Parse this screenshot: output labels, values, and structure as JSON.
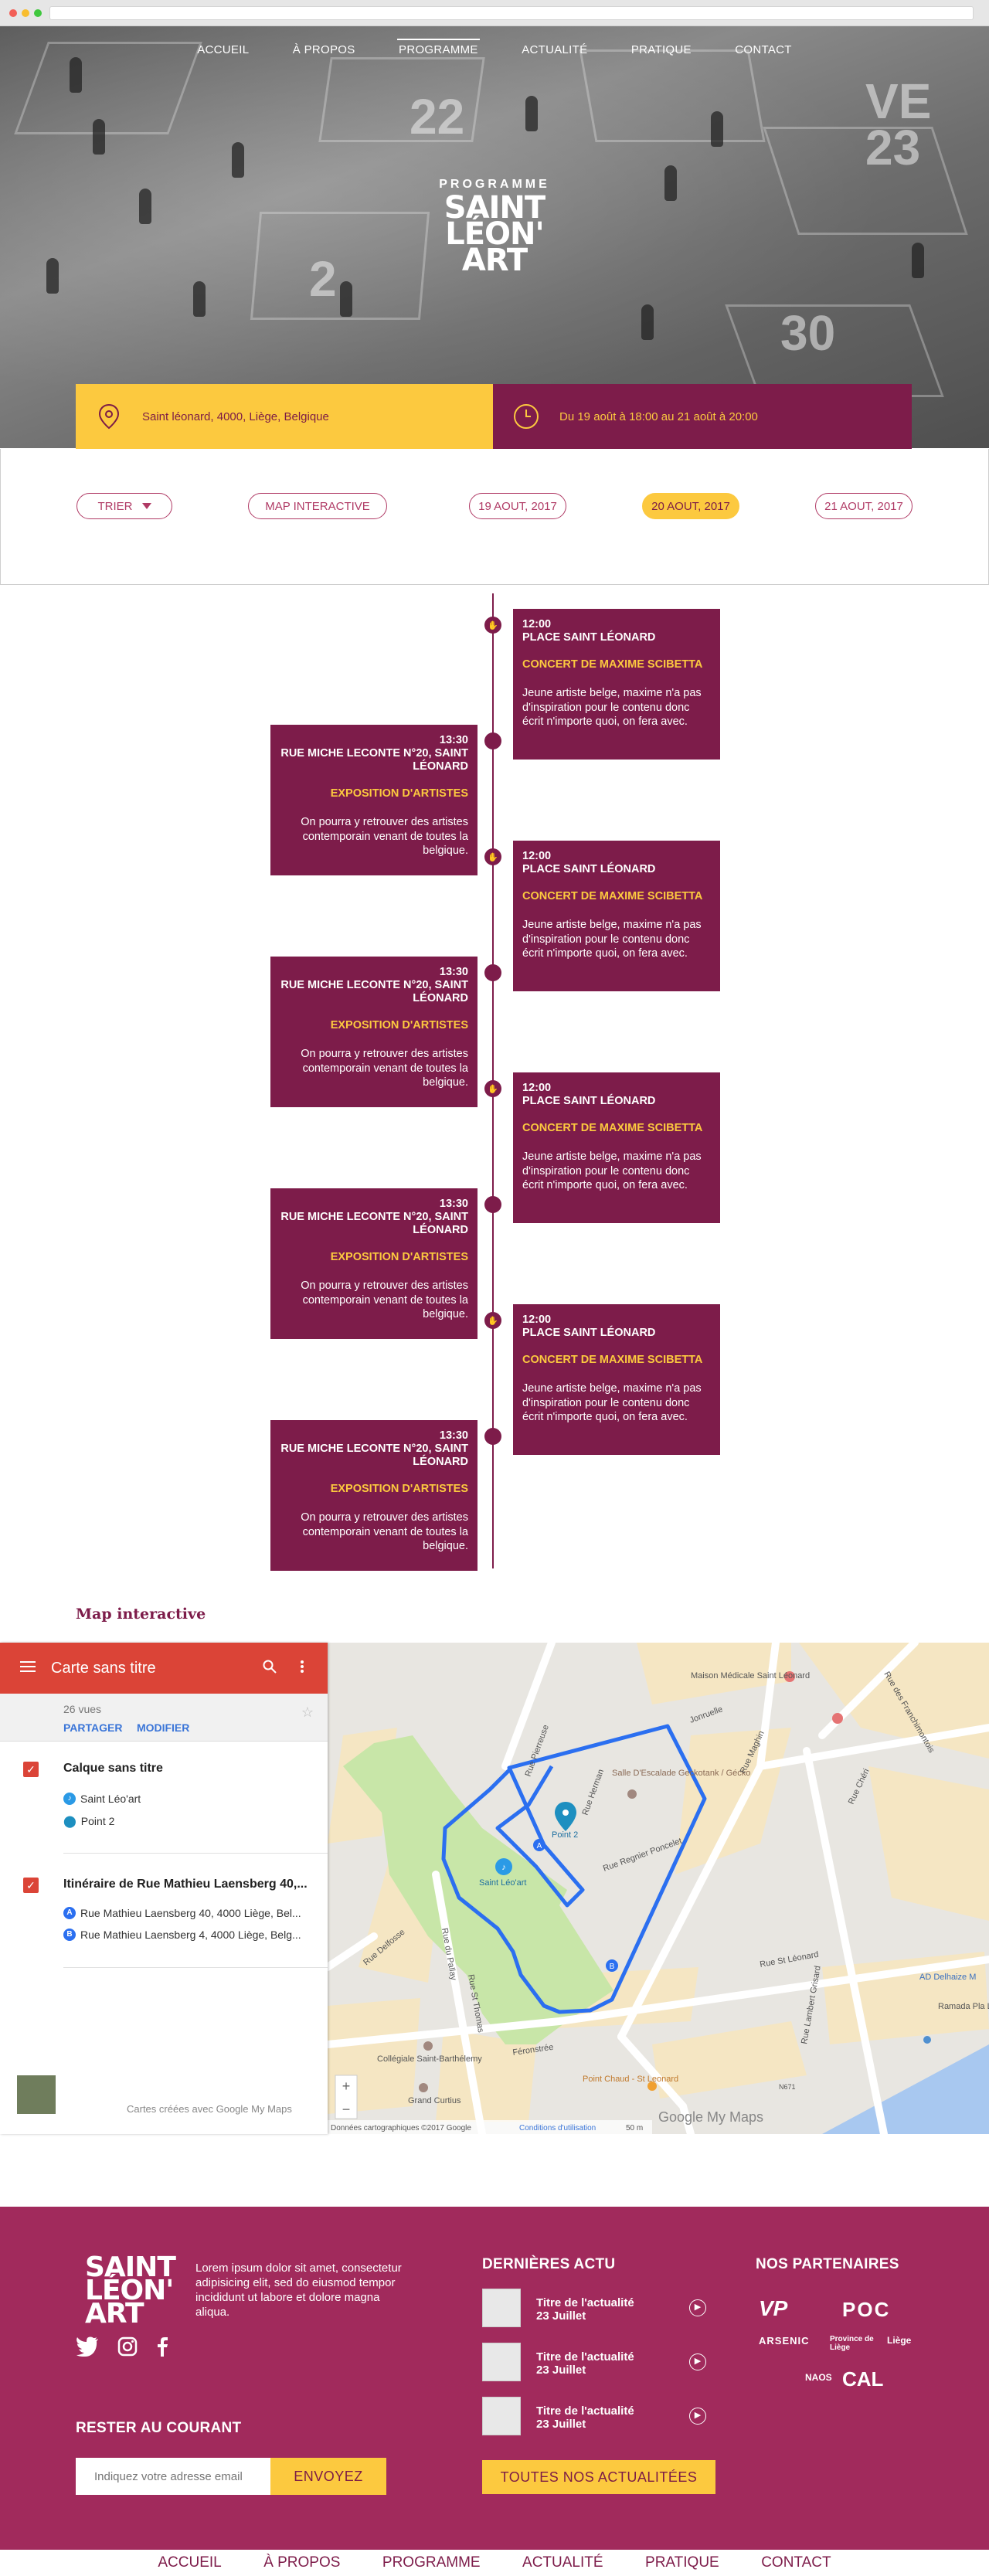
{
  "nav": {
    "items": [
      "ACCUEIL",
      "À PROPOS",
      "PROGRAMME",
      "ACTUALITÉ",
      "PRATIQUE",
      "CONTACT"
    ],
    "active": "PROGRAMME"
  },
  "hero": {
    "subtitle": "PROGRAMME",
    "logo_lines": [
      "SAINT",
      "LÉON'",
      "ART"
    ],
    "location": "Saint léonard, 4000, Liège, Belgique",
    "dates": "Du 19 août à 18:00 au 21 août à 20:00"
  },
  "filters": {
    "sort_label": "TRIER",
    "map_label": "MAP INTERACTIVE",
    "days": [
      "19 AOUT, 2017",
      "20 AOUT, 2017",
      "21 AOUT, 2017"
    ],
    "selected_day": "20 AOUT, 2017"
  },
  "timeline": {
    "events": [
      {
        "side": "right",
        "time": "12:00",
        "place": "PLACE SAINT LÉONARD",
        "title": "CONCERT DE MAXIME SCIBETTA",
        "desc": "Jeune artiste belge, maxime n'a pas d'inspiration pour le contenu donc écrit n'importe quoi, on fera avec."
      },
      {
        "side": "left",
        "time": "13:30",
        "place": "RUE MICHE LECONTE N°20, SAINT LÉONARD",
        "title": "EXPOSITION D'ARTISTES",
        "desc": "On pourra y retrouver des artistes contemporain venant de toutes la belgique."
      },
      {
        "side": "right",
        "time": "12:00",
        "place": "PLACE SAINT LÉONARD",
        "title": "CONCERT DE MAXIME SCIBETTA",
        "desc": "Jeune artiste belge, maxime n'a pas d'inspiration pour le contenu donc écrit n'importe quoi, on fera avec."
      },
      {
        "side": "left",
        "time": "13:30",
        "place": "RUE MICHE LECONTE N°20, SAINT LÉONARD",
        "title": "EXPOSITION D'ARTISTES",
        "desc": "On pourra y retrouver des artistes contemporain venant de toutes la belgique."
      },
      {
        "side": "right",
        "time": "12:00",
        "place": "PLACE SAINT LÉONARD",
        "title": "CONCERT DE MAXIME SCIBETTA",
        "desc": "Jeune artiste belge, maxime n'a pas d'inspiration pour le contenu donc écrit n'importe quoi, on fera avec."
      },
      {
        "side": "left",
        "time": "13:30",
        "place": "RUE MICHE LECONTE N°20, SAINT LÉONARD",
        "title": "EXPOSITION D'ARTISTES",
        "desc": "On pourra y retrouver des artistes contemporain venant de toutes la belgique."
      },
      {
        "side": "right",
        "time": "12:00",
        "place": "PLACE SAINT LÉONARD",
        "title": "CONCERT DE MAXIME SCIBETTA",
        "desc": "Jeune artiste belge, maxime n'a pas d'inspiration pour le contenu donc écrit n'importe quoi, on fera avec."
      },
      {
        "side": "left",
        "time": "13:30",
        "place": "RUE MICHE LECONTE N°20, SAINT LÉONARD",
        "title": "EXPOSITION D'ARTISTES",
        "desc": "On pourra y retrouver des artistes contemporain venant de toutes la belgique."
      }
    ]
  },
  "map": {
    "section_title": "Map interactive",
    "panel_title": "Carte sans titre",
    "views": "26 vues",
    "share": "PARTAGER",
    "edit": "MODIFIER",
    "layer1": {
      "name": "Calque sans titre",
      "items": [
        "Saint Léo'art",
        "Point 2"
      ]
    },
    "layer2": {
      "name": "Itinéraire de Rue Mathieu Laensberg 40,...",
      "items": [
        "Rue Mathieu Laensberg 40, 4000 Liège, Bel...",
        "Rue Mathieu Laensberg 4, 4000 Liège, Belg..."
      ]
    },
    "footer_note": "Cartes créées avec Google My Maps",
    "labels": {
      "maison": "Maison Médicale Saint Léonard",
      "salle": "Salle D'Escalade Geckotank / Gécko",
      "point2": "Point 2",
      "saintleo": "Saint Léo'art",
      "collegiale": "Collégiale Saint-Barthélemy",
      "grandcurtius": "Grand Curtius",
      "pointchaud": "Point Chaud - St Leonard",
      "delhaize": "AD Delhaize M",
      "ramada": "Ramada Pla Liège City Ce",
      "r_pierreuse": "Rue Pierreuse",
      "r_regnier": "Rue Regnier Poncelet",
      "r_stleonard": "Rue St Léonard",
      "r_ferronstree": "Féronstrée",
      "r_delfosse": "Rue Delfosse",
      "r_jonruelle": "Jonruelle",
      "r_maghin": "Rue Maghin",
      "r_franchimontois": "Rue des Franchimontois",
      "r_cheri": "Rue Chéri",
      "r_pallay": "Rue du Pallay",
      "r_stthomas": "Rue St Thomas",
      "r_lambert": "Rue Lambert Grisard",
      "r_hocheporte": "Rue Herman",
      "n671": "N671",
      "attribution": "Données cartographiques ©2017 Google",
      "terms": "Conditions d'utilisation",
      "scale": "50 m",
      "google": "Google My Maps"
    }
  },
  "footer": {
    "logo_lines": [
      "SAINT",
      "LÉON'",
      "ART"
    ],
    "about": "Lorem ipsum dolor sit amet, consectetur adipisicing elit, sed do eiusmod tempor incididunt ut labore et dolore magna aliqua.",
    "newsletter_heading": "RESTER AU COURANT",
    "newsletter_placeholder": "Indiquez votre adresse email",
    "newsletter_button": "ENVOYEZ",
    "news_heading": "DERNIÈRES ACTU",
    "news": [
      {
        "title": "Titre de l'actualité",
        "date": "23 Juillet"
      },
      {
        "title": "Titre de l'actualité",
        "date": "23 Juillet"
      },
      {
        "title": "Titre de l'actualité",
        "date": "23 Juillet"
      }
    ],
    "news_button": "TOUTES NOS ACTUALITÉES",
    "partners_heading": "NOS PARTENAIRES",
    "partners": [
      "VP",
      "POC",
      "ARSENIC",
      "Province de Liège",
      "Liège",
      "NAOS",
      "CAL"
    ],
    "bottom_nav": [
      "ACCUEIL",
      "À PROPOS",
      "PROGRAMME",
      "ACTUALITÉ",
      "PRATIQUE",
      "CONTACT"
    ]
  },
  "colors": {
    "primary": "#7d1c4a",
    "accent": "#fcc93f",
    "footer": "#a12a5c",
    "map_red": "#db4437",
    "route": "#1a73e8"
  }
}
